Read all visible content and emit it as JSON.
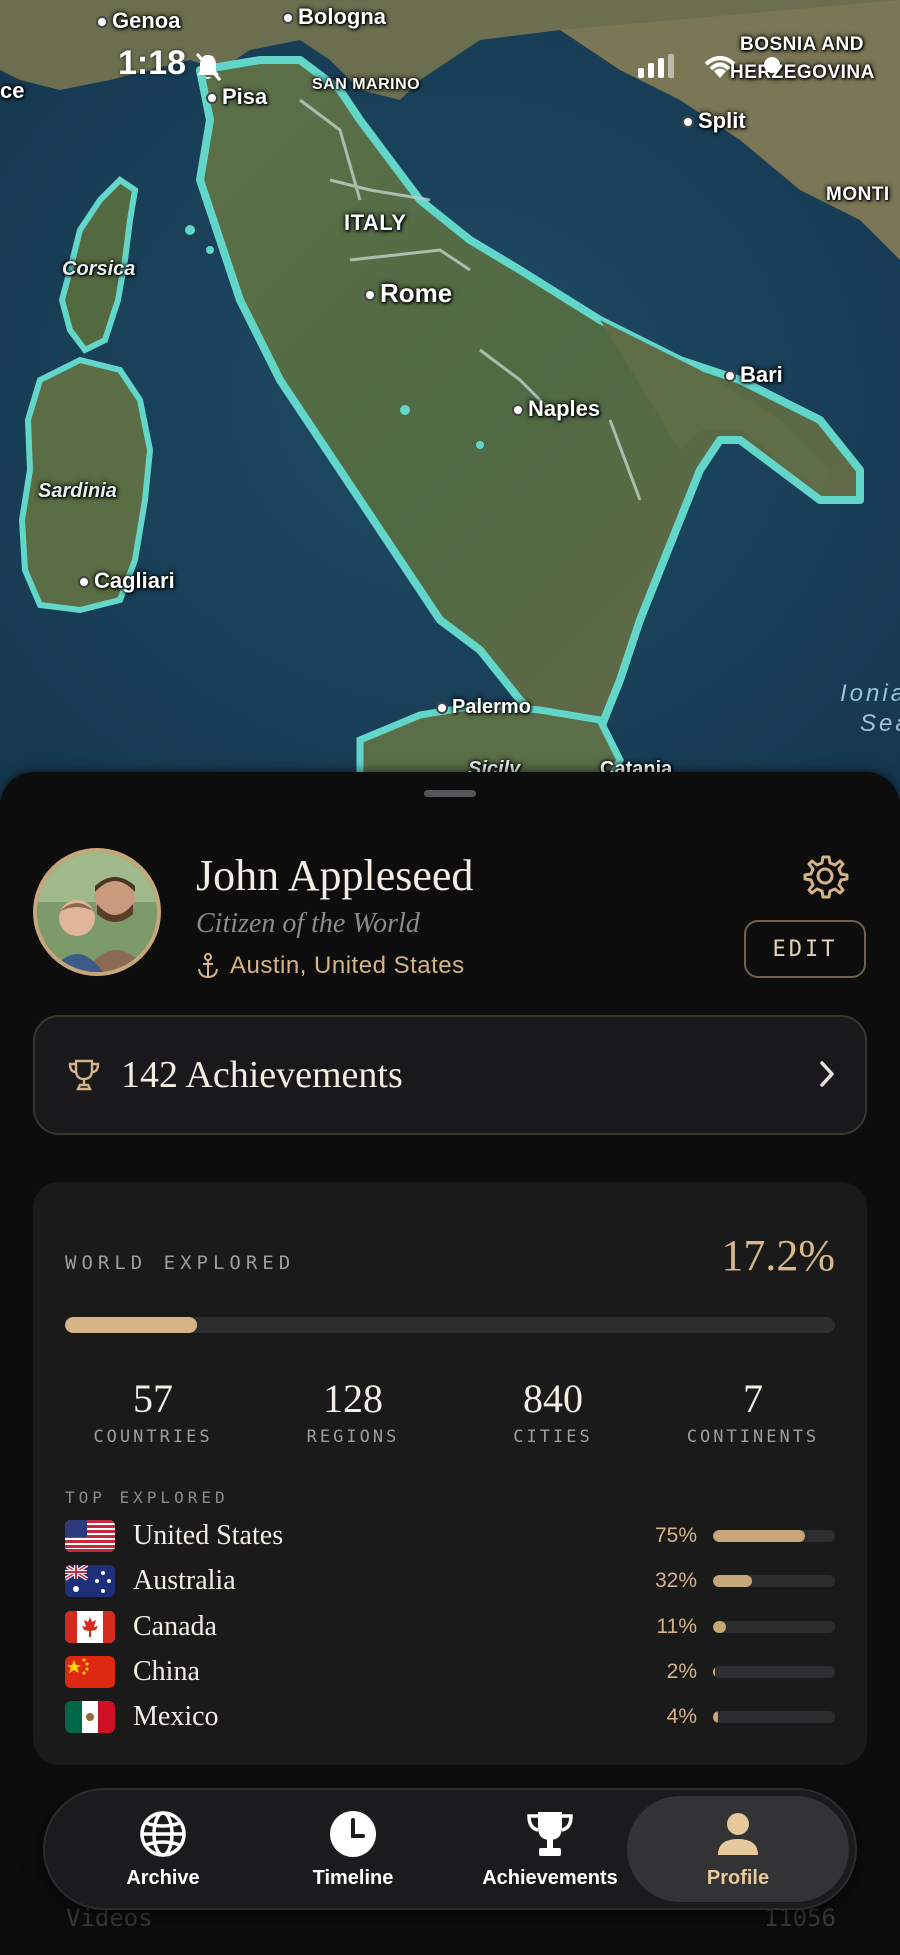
{
  "status_bar": {
    "time": "1:18"
  },
  "map": {
    "labels": {
      "genoa": "Genoa",
      "bologna": "Bologna",
      "pisa": "Pisa",
      "san_marino": "SAN MARINO",
      "france_partial": "ce",
      "bosnia_1": "BOSNIA AND",
      "bosnia_2": "HERZEGOVINA",
      "split": "Split",
      "montenegro": "MONTI",
      "corsica": "Corsica",
      "italy": "ITALY",
      "rome": "Rome",
      "bari": "Bari",
      "naples": "Naples",
      "sardinia": "Sardinia",
      "cagliari": "Cagliari",
      "ionian_1": "Ionia",
      "ionian_2": "Sea",
      "palermo": "Palermo",
      "sicily": "Sicily",
      "catania": "Catania"
    }
  },
  "profile": {
    "name": "John Appleseed",
    "subtitle": "Citizen of the World",
    "location": "Austin, United States",
    "edit_label": "EDIT"
  },
  "achievements": {
    "label": "142 Achievements"
  },
  "world": {
    "title": "WORLD EXPLORED",
    "percent_label": "17.2%",
    "percent": 17.2,
    "stats": [
      {
        "value": "57",
        "label": "COUNTRIES"
      },
      {
        "value": "128",
        "label": "REGIONS"
      },
      {
        "value": "840",
        "label": "CITIES"
      },
      {
        "value": "7",
        "label": "CONTINENTS"
      }
    ],
    "top_title": "TOP EXPLORED",
    "top": [
      {
        "name": "United States",
        "pct_label": "75%",
        "pct": 75,
        "flag": "us"
      },
      {
        "name": "Australia",
        "pct_label": "32%",
        "pct": 32,
        "flag": "au"
      },
      {
        "name": "Canada",
        "pct_label": "11%",
        "pct": 11,
        "flag": "ca"
      },
      {
        "name": "China",
        "pct_label": "2%",
        "pct": 2,
        "flag": "cn"
      },
      {
        "name": "Mexico",
        "pct_label": "4%",
        "pct": 4,
        "flag": "mx"
      }
    ]
  },
  "ghost_row": {
    "label": "Videos",
    "value": "11056"
  },
  "tabs": [
    {
      "label": "Archive",
      "icon": "globe-icon"
    },
    {
      "label": "Timeline",
      "icon": "clock-icon"
    },
    {
      "label": "Achievements",
      "icon": "trophy-icon"
    },
    {
      "label": "Profile",
      "icon": "person-icon",
      "active": true
    }
  ],
  "colors": {
    "accent": "#d6b487",
    "map_outline": "#5fd6c8",
    "sheet": "#0d0d0e",
    "card": "#1a1a1b"
  }
}
